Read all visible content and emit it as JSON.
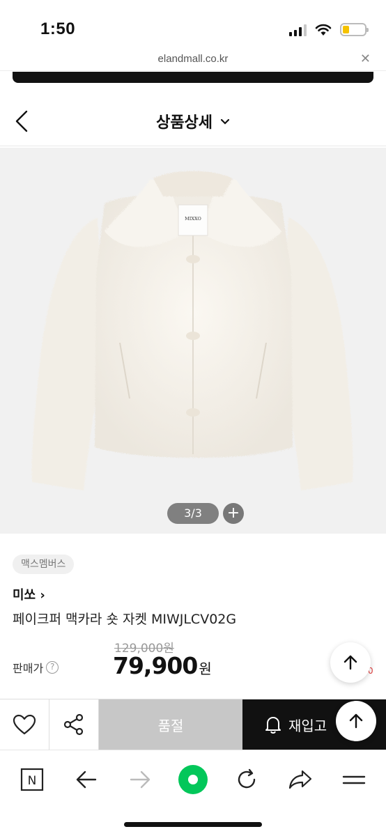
{
  "status_bar": {
    "time": "1:50",
    "battery_color": "#f5c200"
  },
  "browser": {
    "url": "elandmall.co.kr",
    "close_icon": "close-icon"
  },
  "header": {
    "title": "상품상세",
    "back_icon": "chevron-left-icon",
    "dropdown_icon": "chevron-down-icon"
  },
  "gallery": {
    "counter": "3/3",
    "plus_label": "+"
  },
  "product": {
    "brand_badge": "맥스멤버스",
    "brand_name": "미쏘",
    "brand_arrow": "›",
    "name": "페이크퍼 맥카라 숏 자켓 MIWJLCV02G",
    "original_price": "129,000원",
    "price_label": "판매가",
    "help_icon": "?",
    "sale_price": "79,900",
    "currency": "원",
    "red_mark": "0"
  },
  "actions": {
    "wish_icon": "heart-icon",
    "share_icon": "share-icon",
    "soldout_label": "품절",
    "restock_label": "재입고",
    "restock_icon": "bell-icon",
    "scroll_top_icon": "arrow-up-icon"
  },
  "browser_nav": {
    "items": [
      "naver-icon",
      "back-arrow-icon",
      "forward-arrow-icon",
      "home-dot-icon",
      "refresh-icon",
      "share-arrow-icon",
      "menu-icon"
    ],
    "naver_label": "N",
    "accent": "#03c75a"
  }
}
